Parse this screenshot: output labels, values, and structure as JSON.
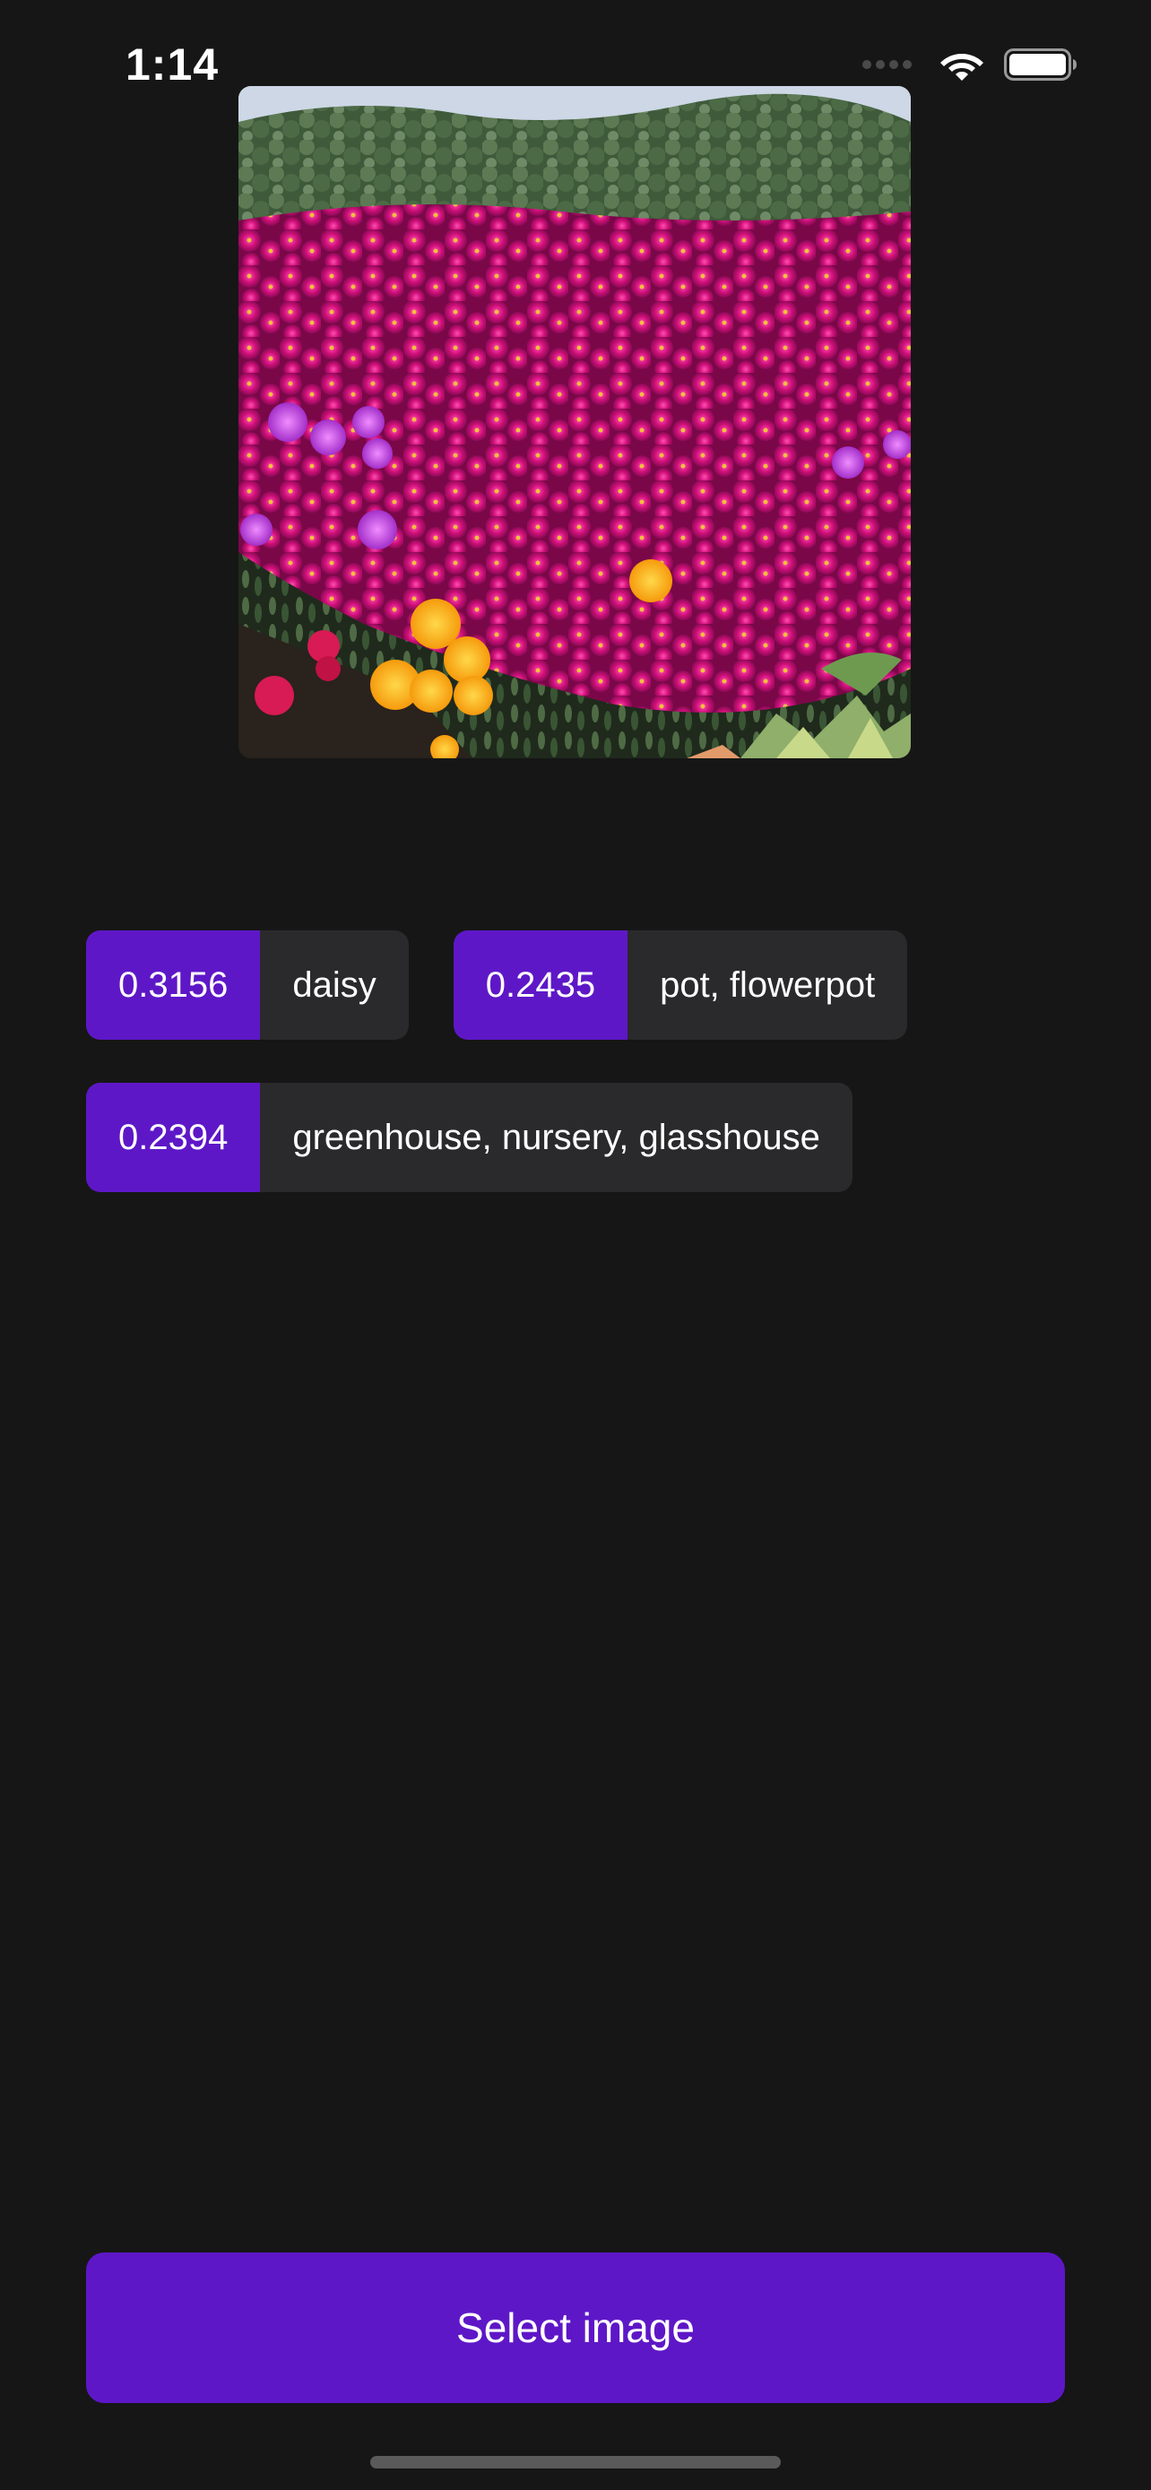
{
  "status_bar": {
    "time": "1:14",
    "icons": [
      "signal-dots-icon",
      "wifi-icon",
      "battery-icon"
    ]
  },
  "photo": {
    "subject": "flower-field-image"
  },
  "predictions": [
    {
      "score": "0.3156",
      "label": "daisy"
    },
    {
      "score": "0.2435",
      "label": "pot, flowerpot"
    },
    {
      "score": "0.2394",
      "label": "greenhouse, nursery, glasshouse"
    }
  ],
  "button": {
    "label": "Select image"
  },
  "colors": {
    "background": "#161616",
    "accent": "#5e17c7",
    "chip_background": "#2a2a2c",
    "text": "#ffffff"
  }
}
